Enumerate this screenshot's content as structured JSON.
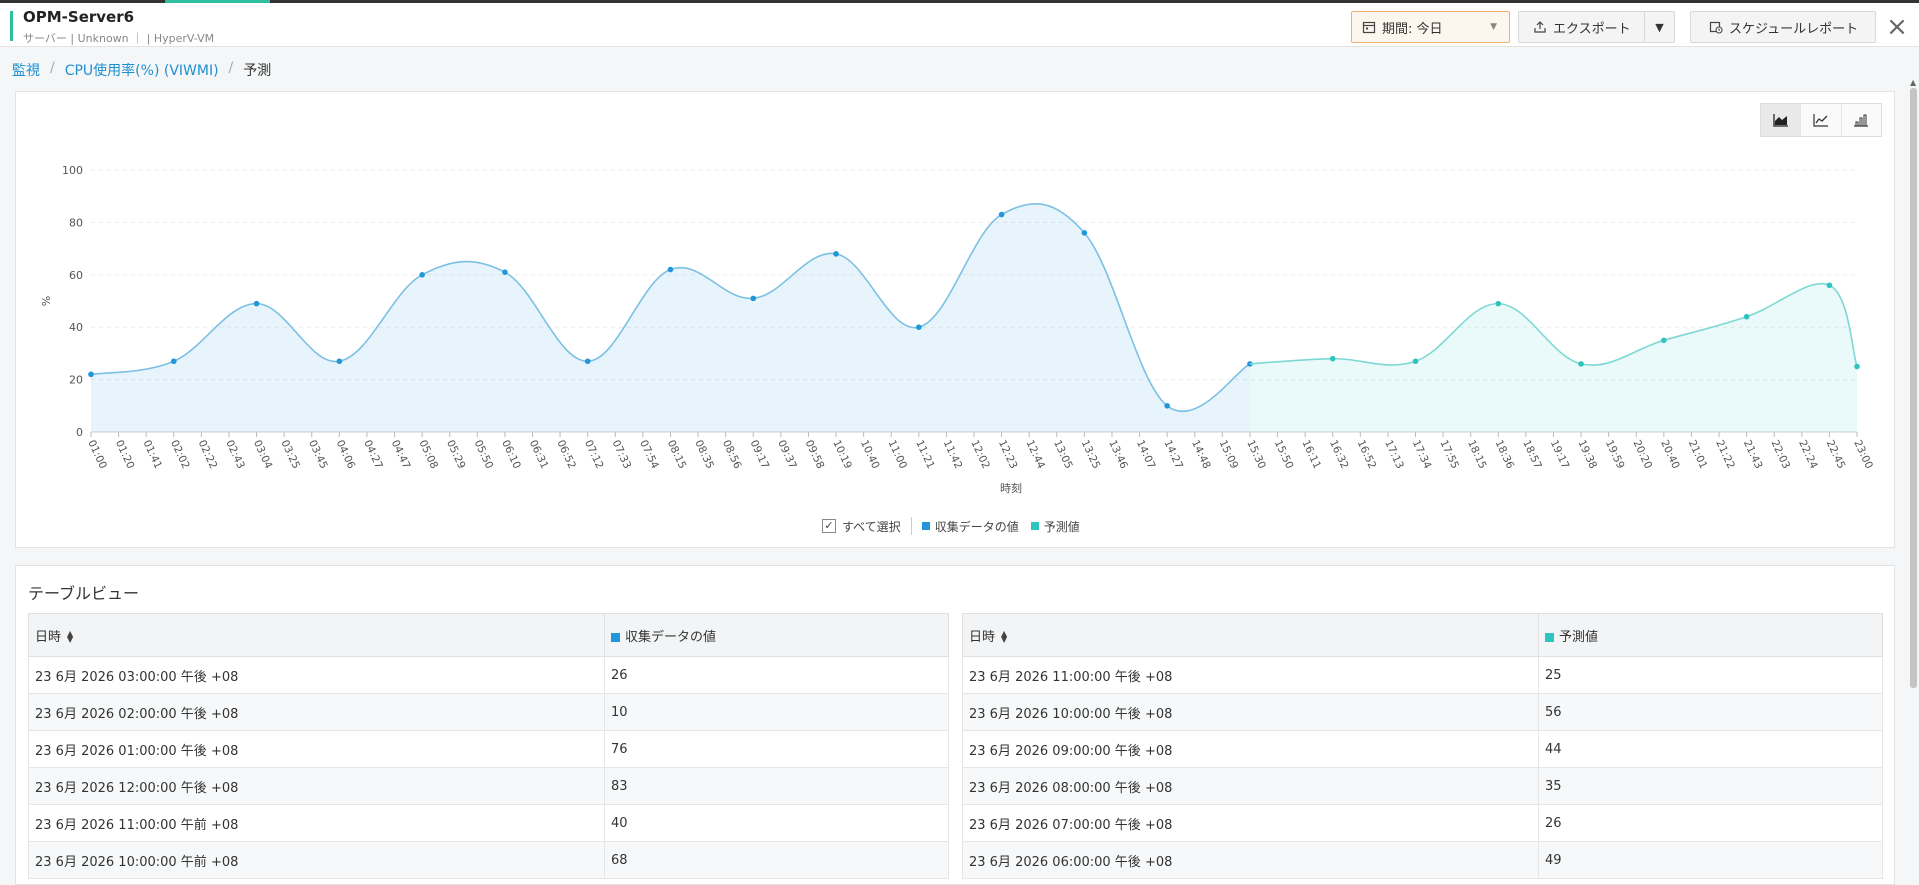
{
  "header": {
    "title": "OPM-Server6",
    "subtitle": "サーバー | Unknown ｜ | HyperV-VM",
    "period_label": "期間:",
    "period_value": "今日",
    "export_label": "エクスポート",
    "schedule_label": "スケジュールレポート"
  },
  "breadcrumb": {
    "item1": "監視",
    "item2": "CPU使用率(%) (VIWMI)",
    "item3": "予測"
  },
  "colors": {
    "collected": "#2196d8",
    "forecast": "#2ec4c0",
    "accent": "#2fbf9f"
  },
  "chart_data": {
    "type": "area",
    "xlabel": "時刻",
    "ylabel": "%",
    "ylim": [
      0,
      100
    ],
    "yticks": [
      0,
      20,
      40,
      60,
      80,
      100
    ],
    "x": [
      "01:00",
      "01:20",
      "01:41",
      "02:02",
      "02:22",
      "02:43",
      "03:04",
      "03:25",
      "03:45",
      "04:06",
      "04:27",
      "04:47",
      "05:08",
      "05:29",
      "05:50",
      "06:10",
      "06:31",
      "06:52",
      "07:12",
      "07:33",
      "07:54",
      "08:15",
      "08:35",
      "08:56",
      "09:17",
      "09:37",
      "09:58",
      "10:19",
      "10:40",
      "11:00",
      "11:21",
      "11:42",
      "12:02",
      "12:23",
      "12:44",
      "13:05",
      "13:25",
      "13:46",
      "14:07",
      "14:27",
      "14:48",
      "15:09",
      "15:30",
      "15:50",
      "16:11",
      "16:32",
      "16:52",
      "17:13",
      "17:34",
      "17:55",
      "18:15",
      "18:36",
      "18:57",
      "19:17",
      "19:38",
      "19:59",
      "20:20",
      "20:40",
      "21:01",
      "21:22",
      "21:43",
      "22:03",
      "22:24",
      "22:45",
      "23:00"
    ],
    "series": [
      {
        "name": "収集データの値",
        "points": [
          [
            "01:00",
            22
          ],
          [
            "02:02",
            27
          ],
          [
            "03:04",
            49
          ],
          [
            "04:06",
            27
          ],
          [
            "05:08",
            60
          ],
          [
            "06:10",
            61
          ],
          [
            "07:12",
            27
          ],
          [
            "08:15",
            62
          ],
          [
            "09:17",
            51
          ],
          [
            "10:19",
            68
          ],
          [
            "11:21",
            40
          ],
          [
            "12:23",
            83
          ],
          [
            "13:25",
            76
          ],
          [
            "14:27",
            10
          ],
          [
            "15:30",
            26
          ]
        ]
      },
      {
        "name": "予測値",
        "points": [
          [
            "15:30",
            26
          ],
          [
            "16:32",
            28
          ],
          [
            "17:34",
            27
          ],
          [
            "18:36",
            49
          ],
          [
            "19:38",
            26
          ],
          [
            "20:40",
            35
          ],
          [
            "21:43",
            44
          ],
          [
            "22:45",
            56
          ],
          [
            "23:45",
            25
          ]
        ]
      }
    ],
    "legend": {
      "select_all": "すべて選択",
      "placement": "bottom-center"
    }
  },
  "table": {
    "title": "テーブルビュー",
    "left": {
      "col1": "日時",
      "col2": "収集データの値",
      "rows": [
        {
          "time": "23 6月 2026 03:00:00 午後 +08",
          "value": "26"
        },
        {
          "time": "23 6月 2026 02:00:00 午後 +08",
          "value": "10"
        },
        {
          "time": "23 6月 2026 01:00:00 午後 +08",
          "value": "76"
        },
        {
          "time": "23 6月 2026 12:00:00 午後 +08",
          "value": "83"
        },
        {
          "time": "23 6月 2026 11:00:00 午前 +08",
          "value": "40"
        },
        {
          "time": "23 6月 2026 10:00:00 午前 +08",
          "value": "68"
        }
      ]
    },
    "right": {
      "col1": "日時",
      "col2": "予測値",
      "rows": [
        {
          "time": "23 6月 2026 11:00:00 午後 +08",
          "value": "25"
        },
        {
          "time": "23 6月 2026 10:00:00 午後 +08",
          "value": "56"
        },
        {
          "time": "23 6月 2026 09:00:00 午後 +08",
          "value": "44"
        },
        {
          "time": "23 6月 2026 08:00:00 午後 +08",
          "value": "35"
        },
        {
          "time": "23 6月 2026 07:00:00 午後 +08",
          "value": "26"
        },
        {
          "time": "23 6月 2026 06:00:00 午後 +08",
          "value": "49"
        }
      ]
    }
  }
}
